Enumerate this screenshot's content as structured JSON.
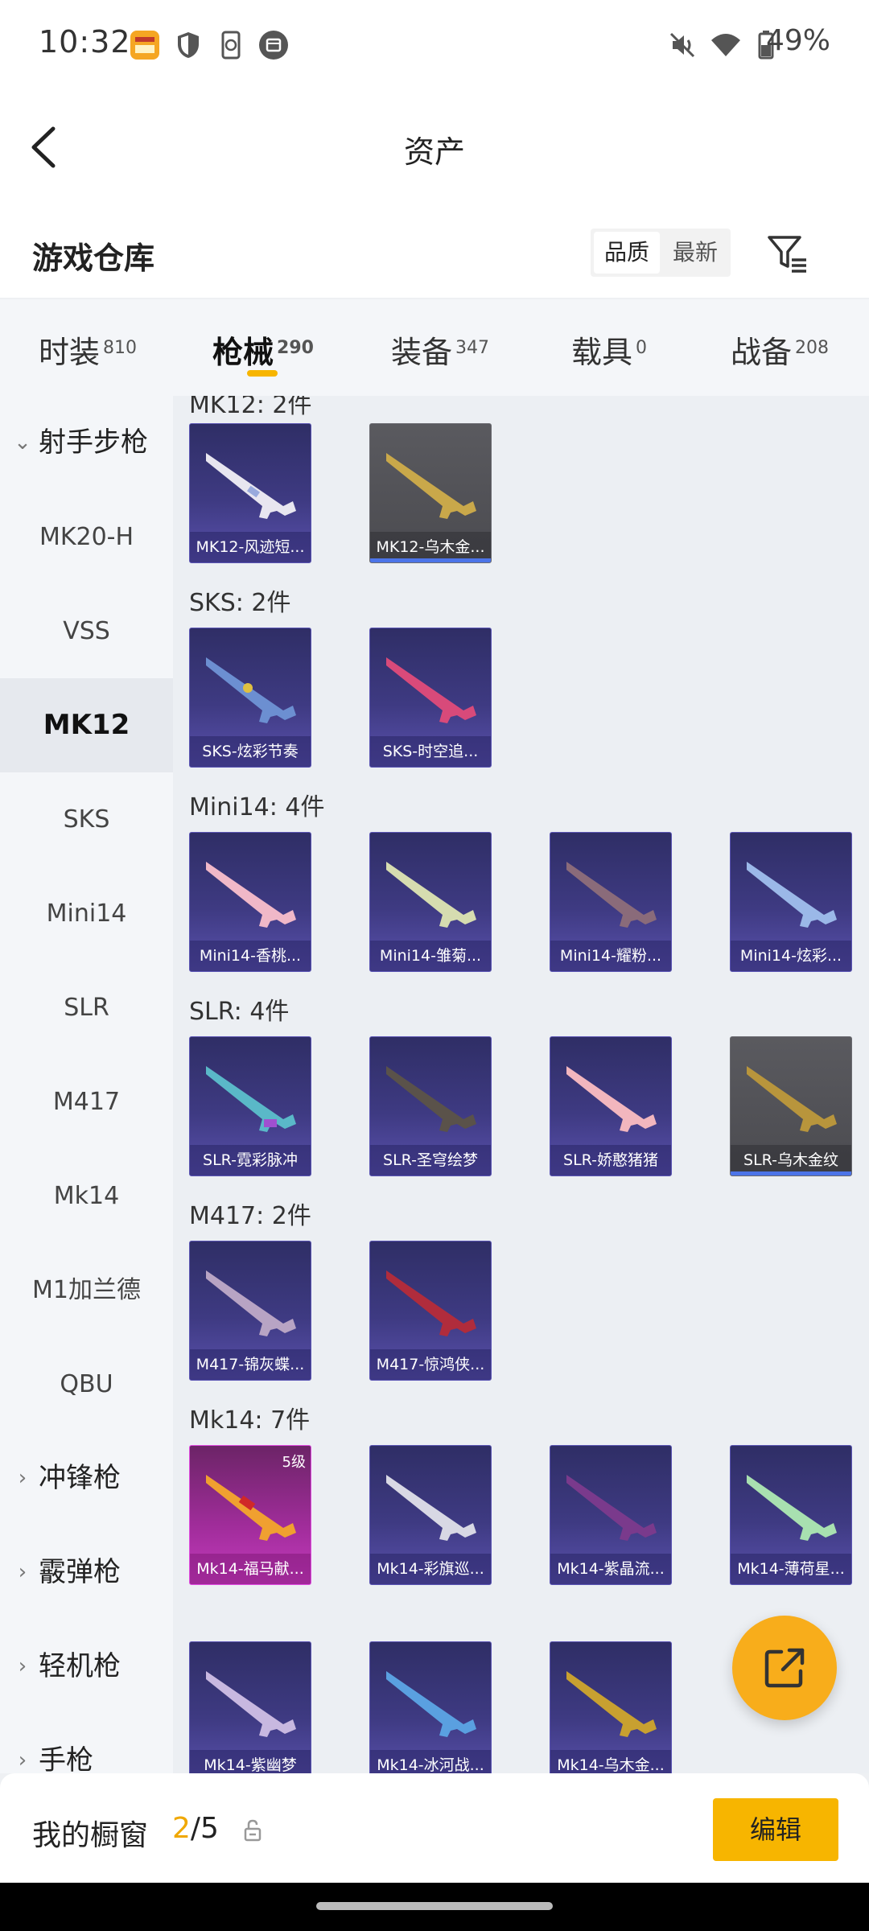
{
  "status": {
    "time": "10:32",
    "battery": "49%"
  },
  "header": {
    "title": "资产"
  },
  "warehouse": {
    "title": "游戏仓库",
    "sort_quality": "品质",
    "sort_newest": "最新"
  },
  "tabs": [
    {
      "label": "时装",
      "count": "810"
    },
    {
      "label": "枪械",
      "count": "290"
    },
    {
      "label": "装备",
      "count": "347"
    },
    {
      "label": "载具",
      "count": "0"
    },
    {
      "label": "战备",
      "count": "208"
    }
  ],
  "sidebar": {
    "group_open": "射手步枪",
    "items": [
      "MK20-H",
      "VSS",
      "MK12",
      "SKS",
      "Mini14",
      "SLR",
      "M417",
      "Mk14",
      "M1加兰德",
      "QBU"
    ],
    "groups": [
      "冲锋枪",
      "霰弹枪",
      "轻机枪",
      "手枪"
    ]
  },
  "sections": [
    {
      "label": "MK12: 2件",
      "items": [
        "MK12-风迹短...",
        "MK12-乌木金..."
      ]
    },
    {
      "label": "SKS: 2件",
      "items": [
        "SKS-炫彩节奏",
        "SKS-时空追..."
      ]
    },
    {
      "label": "Mini14: 4件",
      "items": [
        "Mini14-香桃...",
        "Mini14-雏菊...",
        "Mini14-耀粉...",
        "Mini14-炫彩..."
      ]
    },
    {
      "label": "SLR: 4件",
      "items": [
        "SLR-霓彩脉冲",
        "SLR-圣穹绘梦",
        "SLR-娇憨猪猪",
        "SLR-乌木金纹"
      ]
    },
    {
      "label": "M417: 2件",
      "items": [
        "M417-锦灰蝶...",
        "M417-惊鸿侠..."
      ]
    },
    {
      "label": "Mk14: 7件",
      "items": [
        "Mk14-福马献...",
        "Mk14-彩旗巡...",
        "Mk14-紫晶流...",
        "Mk14-薄荷星...",
        "Mk14-紫幽梦",
        "Mk14-冰河战...",
        "Mk14-乌木金..."
      ],
      "level_badge": "5级"
    }
  ],
  "showcase": {
    "label": "我的橱窗",
    "current": "2",
    "total": "/5",
    "edit": "编辑"
  },
  "colors": {
    "accent": "#f7b500",
    "card_purple": "#3e3a82",
    "card_grey": "#4f4f54",
    "card_pink": "#a22d9c"
  }
}
